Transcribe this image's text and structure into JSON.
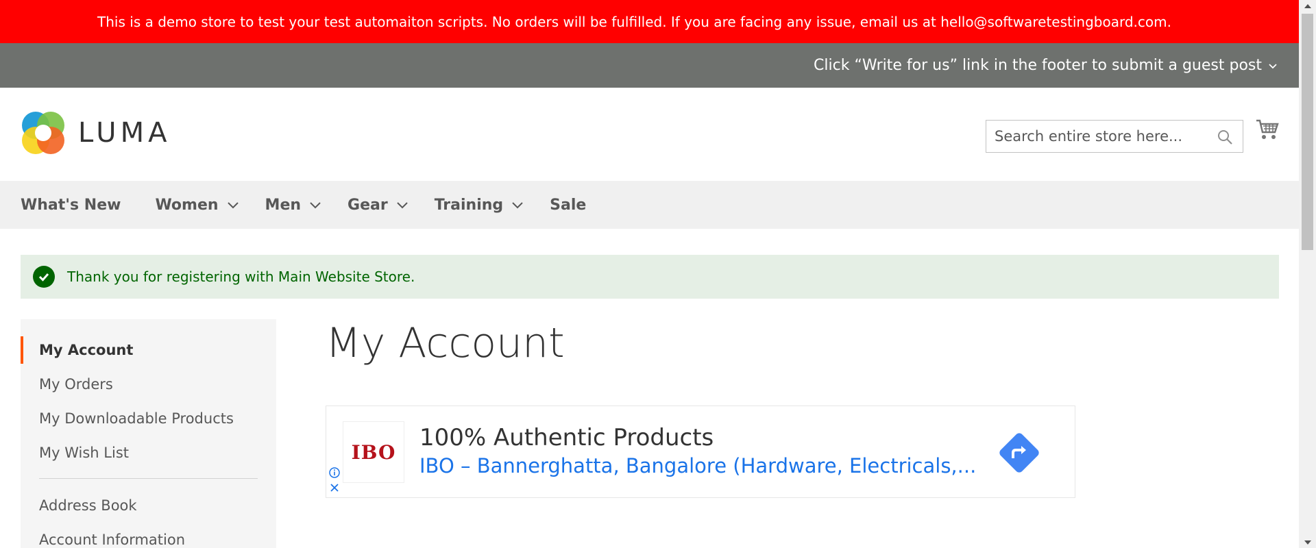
{
  "demo_notice": "This is a demo store to test your test automaiton scripts. No orders will be fulfilled. If you are facing any issue, email us at hello@softwaretestingboard.com.",
  "promo": {
    "text": "Click “Write for us” link in the footer to submit a guest post"
  },
  "header": {
    "logo_text": "LUMA",
    "search_placeholder": "Search entire store here...",
    "cart_icon": "cart-icon"
  },
  "nav": {
    "items": [
      {
        "label": "What's New",
        "has_dropdown": false
      },
      {
        "label": "Women",
        "has_dropdown": true
      },
      {
        "label": "Men",
        "has_dropdown": true
      },
      {
        "label": "Gear",
        "has_dropdown": true
      },
      {
        "label": "Training",
        "has_dropdown": true
      },
      {
        "label": "Sale",
        "has_dropdown": false
      }
    ]
  },
  "message": {
    "text": "Thank you for registering with Main Website Store."
  },
  "sidebar": {
    "items": [
      {
        "label": "My Account",
        "active": true
      },
      {
        "label": "My Orders"
      },
      {
        "label": "My Downloadable Products"
      },
      {
        "label": "My Wish List"
      },
      {
        "label": "Address Book"
      },
      {
        "label": "Account Information"
      }
    ]
  },
  "page_title": "My Account",
  "ad": {
    "logo_text": "IBO",
    "headline": "100% Authentic Products",
    "subline": "IBO – Bannerghatta, Bangalore (Hardware, Electricals,..."
  },
  "colors": {
    "demo_bar": "#ff0000",
    "promo_bar": "#6e716e",
    "nav_bg": "#f0f0f0",
    "success_bg": "#e5efe5",
    "success_text": "#006400",
    "active_marker": "#ff5501",
    "ad_link": "#1a73e8",
    "ad_arrow": "#4285f4"
  }
}
